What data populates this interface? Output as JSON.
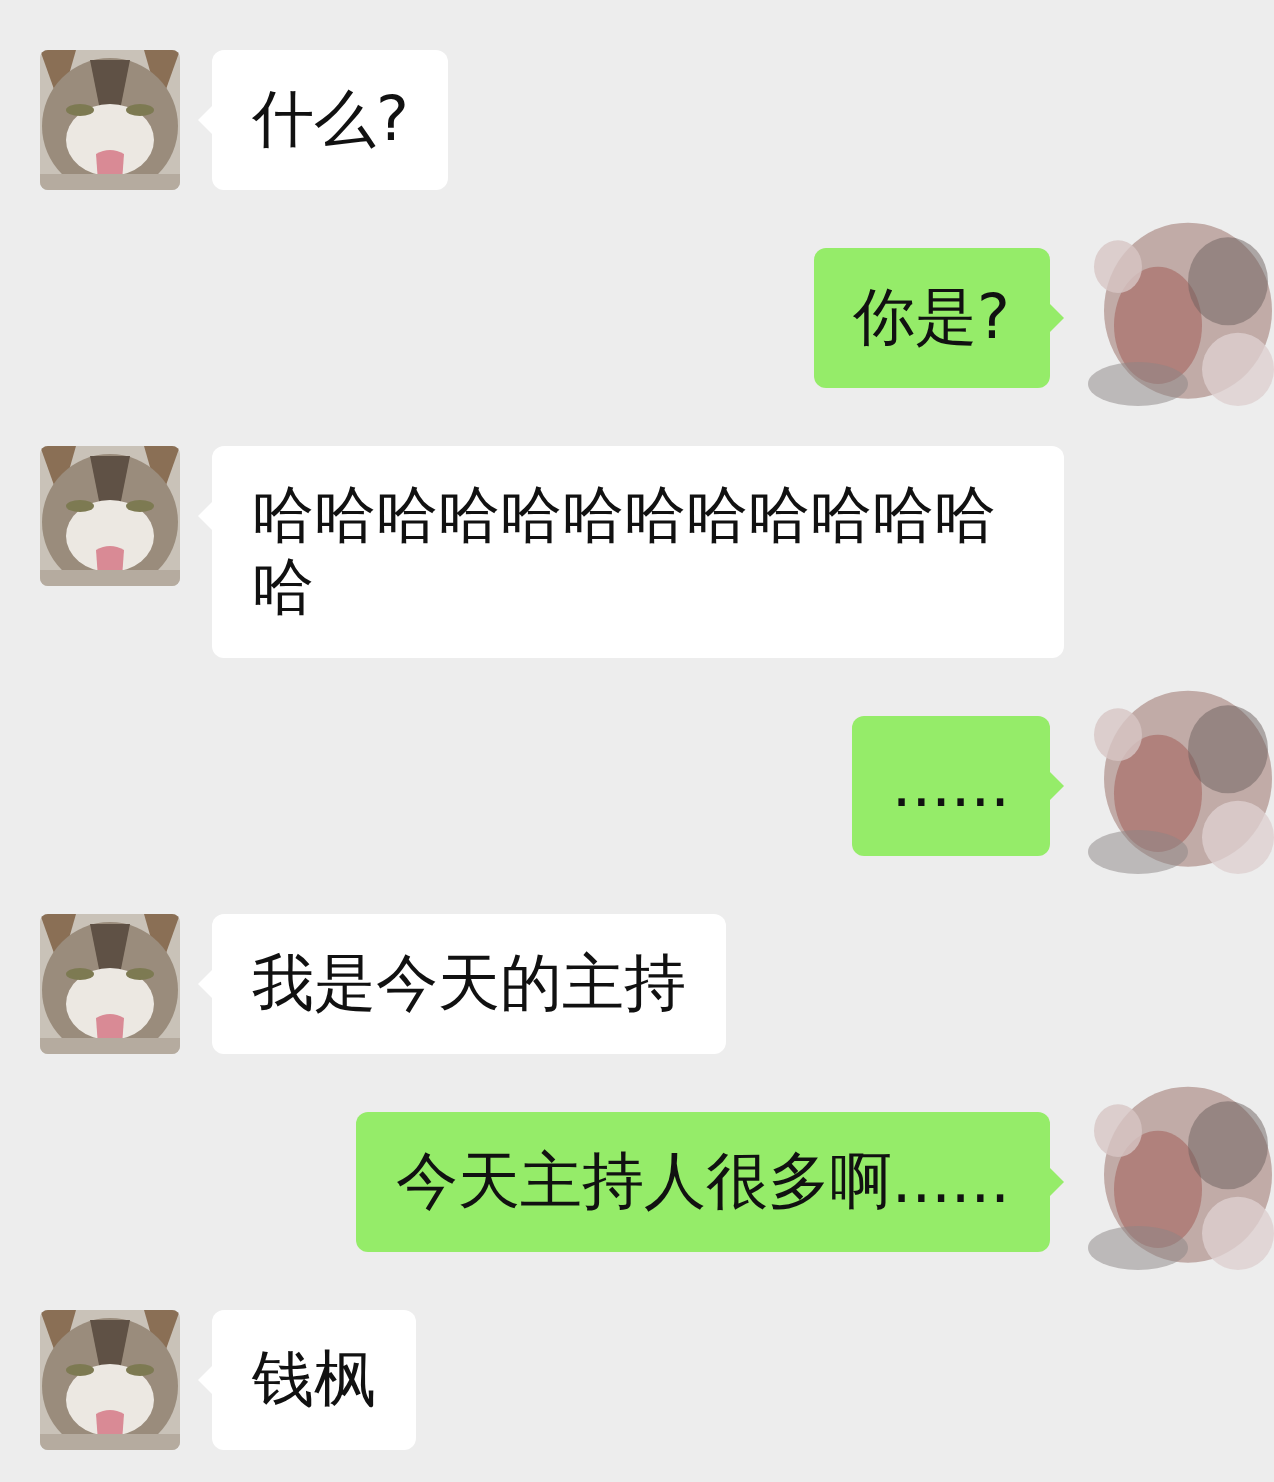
{
  "messages": [
    {
      "kind": "received",
      "text": "什么?"
    },
    {
      "kind": "sent",
      "text": "你是?"
    },
    {
      "kind": "received",
      "text": "哈哈哈哈哈哈哈哈哈哈哈哈哈"
    },
    {
      "kind": "sent",
      "text": "......"
    },
    {
      "kind": "received",
      "text": "我是今天的主持"
    },
    {
      "kind": "sent",
      "text": "今天主持人很多啊......"
    },
    {
      "kind": "received",
      "text": "钱枫"
    }
  ]
}
